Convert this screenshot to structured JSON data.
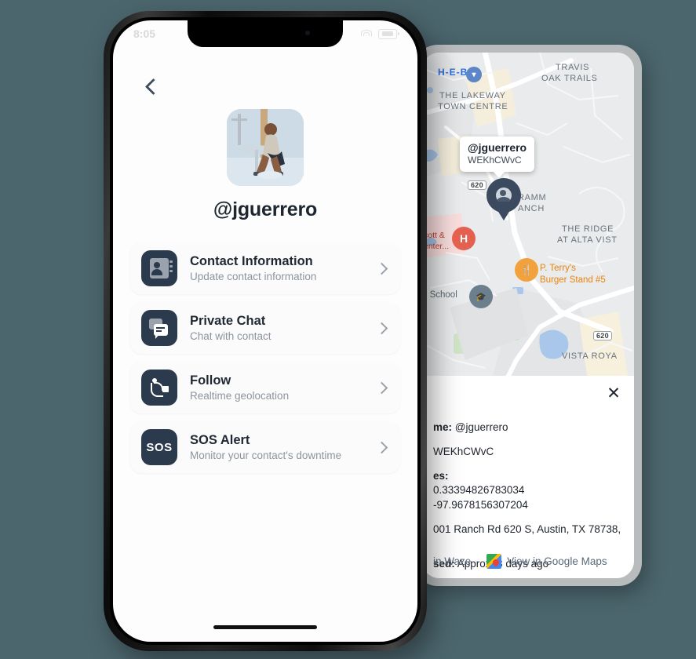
{
  "theme": {
    "background": "#4c666e",
    "icon_tile": "#2c3a4e",
    "accent_text": "#1f2833",
    "muted_text": "#8d949c"
  },
  "left_phone": {
    "status_bar": {
      "time": "8:05",
      "wifi_icon": "wifi-icon",
      "battery_icon": "battery-icon"
    },
    "back_button": "back-chevron-icon",
    "profile": {
      "avatar_alt": "profile-photo",
      "username": "@jguerrero"
    },
    "menu": [
      {
        "icon": "contact-card-icon",
        "title": "Contact Information",
        "subtitle": "Update contact information",
        "chevron": "chevron-right-icon"
      },
      {
        "icon": "chat-bubble-icon",
        "title": "Private Chat",
        "subtitle": "Chat with contact",
        "chevron": "chevron-right-icon"
      },
      {
        "icon": "route-path-icon",
        "title": "Follow",
        "subtitle": "Realtime geolocation",
        "chevron": "chevron-right-icon"
      },
      {
        "icon": "sos-icon",
        "title": "SOS Alert",
        "subtitle": "Monitor your contact's downtime",
        "chevron": "chevron-right-icon"
      }
    ]
  },
  "right_phone": {
    "map": {
      "callout": {
        "title": "@jguerrero",
        "subtitle": "WEKhCWvC"
      },
      "labels": [
        {
          "text": "H-E-B",
          "type": "brand"
        },
        {
          "text": "TRAVIS",
          "type": "area"
        },
        {
          "text": "OAK TRAILS",
          "type": "area"
        },
        {
          "text": "THE LAKEWAY",
          "type": "area"
        },
        {
          "text": "TOWN CENTRE",
          "type": "area"
        },
        {
          "text": "THE RIDGE",
          "type": "area"
        },
        {
          "text": "AT ALTA VIST",
          "type": "area"
        },
        {
          "text": "VISTA ROYA",
          "type": "area"
        },
        {
          "text": "RAMM",
          "type": "area"
        },
        {
          "text": "ANCH",
          "type": "area"
        },
        {
          "text": "cott &",
          "type": "hospital"
        },
        {
          "text": "enter...",
          "type": "hospital"
        },
        {
          "text": "P. Terry's",
          "type": "poi"
        },
        {
          "text": "Burger Stand #5",
          "type": "poi"
        },
        {
          "text": "h School",
          "type": "school"
        }
      ],
      "highway_shields": [
        "620",
        "620"
      ],
      "user_pin": "user-location-pin",
      "hospital_pin": "hospital-pin",
      "restaurant_pin": "restaurant-pin",
      "school_pin": "school-pin",
      "store_pin": "store-pin"
    },
    "sheet": {
      "close_icon": "close-icon",
      "username_label": "me:",
      "username_value": "@jguerrero",
      "tag_value": "WEKhCWvC",
      "coords_label": "es:",
      "latitude": "0.33394826783034",
      "longitude": "-97.9678156307204",
      "address": "001 Ranch Rd 620 S, Austin, TX 78738,",
      "last_seen_label": "sed:",
      "last_seen_value": "Approx: 3 days ago",
      "links": [
        {
          "label": "in Waze",
          "icon": "waze-icon"
        },
        {
          "label": "View in Google Maps",
          "icon": "google-maps-icon"
        }
      ]
    }
  }
}
